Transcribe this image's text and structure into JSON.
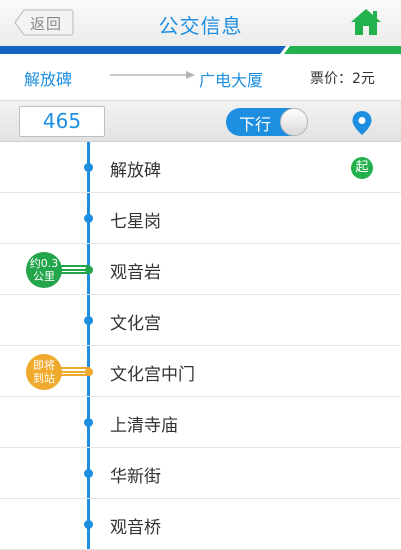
{
  "header": {
    "back_label": "返回",
    "title": "公交信息",
    "home_icon": "home-icon"
  },
  "route": {
    "from": "解放碑",
    "to": "广电大厦",
    "fare": "票价：2元"
  },
  "controls": {
    "route_number": "465",
    "direction_label": "下行",
    "location_icon": "location-pin-icon"
  },
  "colors": {
    "accent": "#1e8fe0",
    "stripe_blue": "#1565c0",
    "stripe_green": "#22b14c",
    "bus_green": "#22a54b",
    "bus_orange": "#f0a92d"
  },
  "stops": [
    {
      "name": "解放碑",
      "badge": "起"
    },
    {
      "name": "七星岗"
    },
    {
      "name": "观音岩",
      "bus_label_1": "约0.3",
      "bus_label_2": "公里"
    },
    {
      "name": "文化宫"
    },
    {
      "name": "文化宫中门",
      "bus_label_1": "即将",
      "bus_label_2": "到站"
    },
    {
      "name": "上清寺庙"
    },
    {
      "name": "华新街"
    },
    {
      "name": "观音桥"
    }
  ]
}
